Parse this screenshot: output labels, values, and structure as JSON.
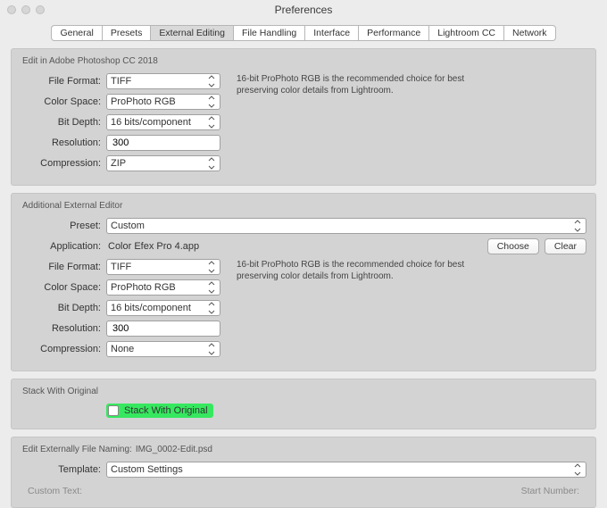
{
  "window": {
    "title": "Preferences"
  },
  "tabs": {
    "general": "General",
    "presets": "Presets",
    "external": "External Editing",
    "filehandling": "File Handling",
    "interface": "Interface",
    "performance": "Performance",
    "lightroomcc": "Lightroom CC",
    "network": "Network"
  },
  "section1": {
    "title": "Edit in Adobe Photoshop CC 2018",
    "labels": {
      "fileformat": "File Format:",
      "colorspace": "Color Space:",
      "bitdepth": "Bit Depth:",
      "resolution": "Resolution:",
      "compression": "Compression:"
    },
    "values": {
      "fileformat": "TIFF",
      "colorspace": "ProPhoto RGB",
      "bitdepth": "16 bits/component",
      "resolution": "300",
      "compression": "ZIP"
    },
    "hint": "16-bit ProPhoto RGB is the recommended choice for best preserving color details from Lightroom."
  },
  "section2": {
    "title": "Additional External Editor",
    "labels": {
      "preset": "Preset:",
      "application": "Application:",
      "fileformat": "File Format:",
      "colorspace": "Color Space:",
      "bitdepth": "Bit Depth:",
      "resolution": "Resolution:",
      "compression": "Compression:"
    },
    "values": {
      "preset": "Custom",
      "application": "Color Efex Pro 4.app",
      "fileformat": "TIFF",
      "colorspace": "ProPhoto RGB",
      "bitdepth": "16 bits/component",
      "resolution": "300",
      "compression": "None"
    },
    "buttons": {
      "choose": "Choose",
      "clear": "Clear"
    },
    "hint": "16-bit ProPhoto RGB is the recommended choice for best preserving color details from Lightroom."
  },
  "section3": {
    "title": "Stack With Original",
    "checkbox_label": "Stack With Original",
    "checked": false
  },
  "section4": {
    "title_prefix": "Edit Externally File Naming:",
    "title_value": "IMG_0002-Edit.psd",
    "labels": {
      "template": "Template:"
    },
    "values": {
      "template": "Custom Settings"
    },
    "bottom": {
      "customtext": "Custom Text:",
      "startnumber": "Start Number:"
    }
  }
}
